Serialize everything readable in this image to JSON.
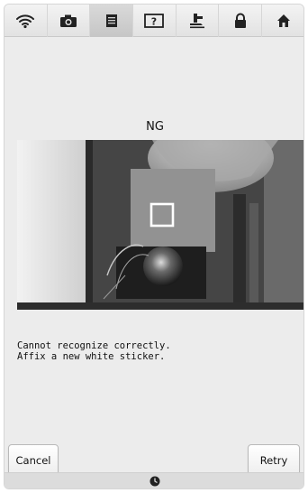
{
  "toolbar": {
    "icons": [
      "wifi-icon",
      "camera-icon",
      "document-icon",
      "help-icon",
      "presser-foot-icon",
      "lock-icon",
      "home-icon"
    ],
    "active_index": 2
  },
  "screen": {
    "title": "NG",
    "message_lines": [
      "Cannot recognize correctly.",
      "Affix a new white sticker."
    ]
  },
  "buttons": {
    "cancel_label": "Cancel",
    "retry_label": "Retry"
  },
  "status_bar": {
    "icon": "clock-icon"
  },
  "colors": {
    "background": "#ececec",
    "toolbar_active": "#c6c6c6",
    "camera_dark": "#3a3a3a"
  }
}
